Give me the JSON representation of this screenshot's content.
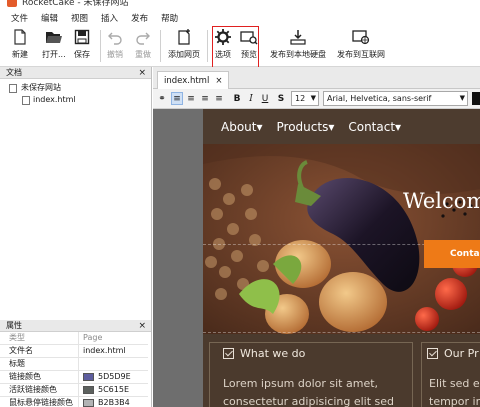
{
  "window": {
    "title": "RocketCake - 未保存网站"
  },
  "menu": [
    "文件",
    "编辑",
    "视图",
    "插入",
    "发布",
    "帮助"
  ],
  "toolbar": {
    "new": "新建",
    "open": "打开...",
    "save": "保存",
    "undo": "撤销",
    "redo": "重做",
    "add_page": "添加网页",
    "options": "选项",
    "preview": "预览",
    "publish_local": "发布到本地硬盘",
    "publish_web": "发布到互联网"
  },
  "documents_panel": {
    "title": "文档",
    "close": "×",
    "site": "未保存网站",
    "page": "index.html"
  },
  "properties_panel": {
    "title": "属性",
    "close": "×",
    "rows": [
      {
        "key": "类型",
        "value": "Page"
      },
      {
        "key": "文件名",
        "value": "index.html"
      },
      {
        "key": "标题",
        "value": ""
      },
      {
        "key": "链接颜色",
        "value": "5D5D9E",
        "color": "#5D5D9E"
      },
      {
        "key": "活跃链接颜色",
        "value": "5C615E",
        "color": "#5C615E"
      },
      {
        "key": "鼠标悬停链接颜色",
        "value": "B2B3B4",
        "color": "#B2B3B4"
      }
    ]
  },
  "editor": {
    "tab_label": "index.html",
    "tab_close": "×",
    "font_size": "12",
    "font_family": "Arial, Helvetica, sans-serif"
  },
  "site_preview": {
    "nav": [
      "About▾",
      "Products▾",
      "Contact▾"
    ],
    "hero_title": "Welcom",
    "hero_cta": "Conta",
    "features": [
      {
        "title": "What we do",
        "body": "Lorem ipsum dolor sit amet,",
        "body2": "consectetur adipisicing elit sed"
      },
      {
        "title": "Our Pr",
        "body": "Elit sed e",
        "body2": "tempor inc"
      }
    ]
  },
  "colors": {
    "highlight": "#e02020",
    "cta": "#ee7a17",
    "site_nav_bg": "#4d3c2f"
  }
}
